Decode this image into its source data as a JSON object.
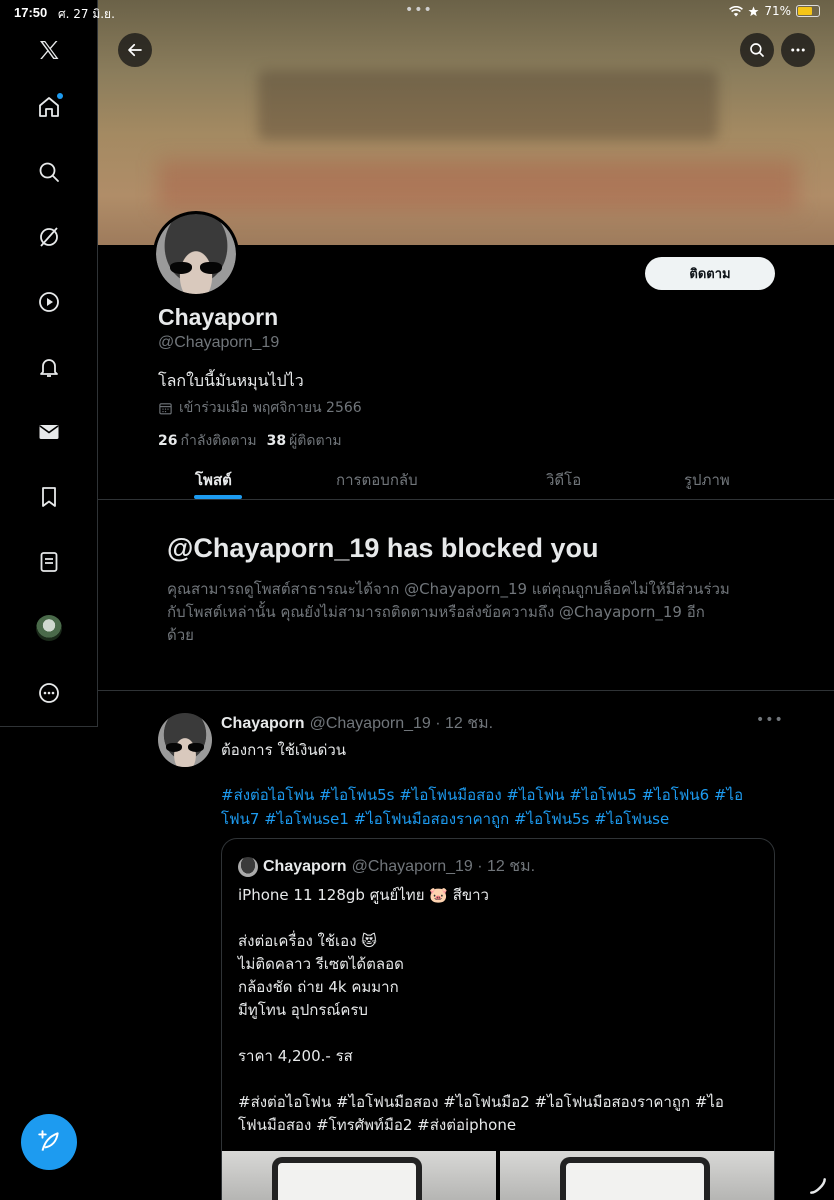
{
  "status_bar": {
    "time": "17:50",
    "date": "ศ. 27 มิ.ย.",
    "dots": "•••",
    "battery": "71%",
    "battery_level": 0.71
  },
  "sidebar": {
    "items": [
      {
        "icon": "x-logo-icon"
      },
      {
        "icon": "home-icon",
        "has_notification_dot": true
      },
      {
        "icon": "search-icon"
      },
      {
        "icon": "grok-icon"
      },
      {
        "icon": "video-icon"
      },
      {
        "icon": "bell-icon"
      },
      {
        "icon": "mail-icon"
      },
      {
        "icon": "bookmark-icon"
      },
      {
        "icon": "list-icon"
      },
      {
        "icon": "profile-avatar-icon"
      },
      {
        "icon": "more-icon"
      }
    ],
    "compose_icon": "compose-post-icon"
  },
  "header": {
    "back_icon": "arrow-left-icon",
    "search_icon": "search-icon",
    "more_icon": "more-icon"
  },
  "profile": {
    "display_name": "Chayaporn",
    "handle": "@Chayaporn_19",
    "bio": "โลกใบนี้มันหมุนไปไว",
    "joined": "เข้าร่วมเมือ พฤศจิกายน 2566",
    "following_count": "26",
    "following_label": "กำลังติดตาม",
    "followers_count": "38",
    "followers_label": "ผู้ติดตาม",
    "follow_button": "ติดตาม"
  },
  "tabs": [
    {
      "label": "โพสต์",
      "active": true
    },
    {
      "label": "การตอบกลับ",
      "active": false
    },
    {
      "label": "วิดีโอ",
      "active": false
    },
    {
      "label": "รูปภาพ",
      "active": false
    }
  ],
  "blocked": {
    "title": "@Chayaporn_19 has blocked you",
    "line1": "คุณสามารถดูโพสต์สาธารณะได้จาก @Chayaporn_19 แต่คุณถูกบล็อคไม่ให้มีส่วนร่วม",
    "line2": "กับโพสต์เหล่านั้น คุณยังไม่สามารถติดตามหรือส่งข้อความถึง @Chayaporn_19 อีก",
    "line3": "ด้วย"
  },
  "tweet": {
    "name": "Chayaporn",
    "meta": "@Chayaporn_19 · 12 ชม.",
    "text": "ต้องการ ใช้เงินด่วน",
    "hashtags_line1": "#ส่งต่อไอโฟน #ไอโฟน5s #ไอโฟนมือสอง  #ไอโฟน #ไอโฟน5 #ไอโฟน6 #ไอ",
    "hashtags_line2": "โฟน7 #ไอโฟนse1 #ไอโฟนมือสองราคาถูก #ไอโฟน5s #ไอโฟนse",
    "more": "•••"
  },
  "quote": {
    "name": "Chayaporn",
    "meta": "@Chayaporn_19 · 12 ชม.",
    "lines": [
      "iPhone 11 128gb ศูนย์ไทย 🐷 สีขาว",
      "",
      "ส่งต่อเครื่อง ใช้เอง 😻",
      "ไม่ติดคลาว รีเซตได้ตลอด",
      "กล้องชัด ถ่าย 4k คมมาก",
      "มีทูโทน อุปกรณ์ครบ",
      "",
      "ราคา 4,200.- รส",
      "",
      "#ส่งต่อไอโฟน #ไอโฟนมือสอง #ไอโฟนมือ2 #ไอโฟนมือสองราคาถูก  #ไอ",
      "โฟนมือสอง #โทรศัพท์มือ2 #ส่งต่อiphone"
    ]
  },
  "colors": {
    "accent": "#1d9bf0",
    "background": "#000000",
    "text_primary": "#e7e9ea",
    "text_secondary": "#71767b",
    "border": "#2f3336"
  }
}
